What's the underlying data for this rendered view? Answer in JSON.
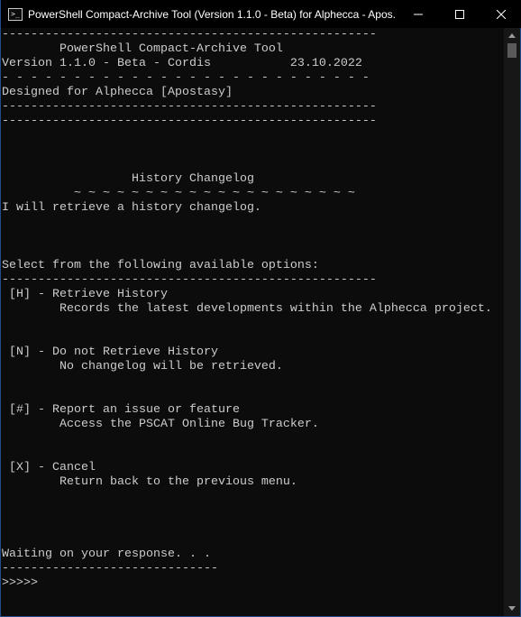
{
  "window": {
    "title": "PowerShell Compact-Archive Tool (Version 1.1.0 - Beta) for Alphecca - Apos...",
    "icon_glyph": ">_"
  },
  "console": {
    "lines": [
      "----------------------------------------------------",
      "        PowerShell Compact-Archive Tool",
      "Version 1.1.0 - Beta - Cordis           23.10.2022",
      "- - - - - - - - - - - - - - - - - - - - - - - - - -",
      "Designed for Alphecca [Apostasy]",
      "----------------------------------------------------",
      "----------------------------------------------------",
      "",
      "",
      "",
      "                  History Changelog",
      "          ~ ~ ~ ~ ~ ~ ~ ~ ~ ~ ~ ~ ~ ~ ~ ~ ~ ~ ~ ~",
      "I will retrieve a history changelog.",
      "",
      "",
      "",
      "Select from the following available options:",
      "----------------------------------------------------",
      " [H] - Retrieve History",
      "        Records the latest developments within the Alphecca project.",
      "",
      "",
      " [N] - Do not Retrieve History",
      "        No changelog will be retrieved.",
      "",
      "",
      " [#] - Report an issue or feature",
      "        Access the PSCAT Online Bug Tracker.",
      "",
      "",
      " [X] - Cancel",
      "        Return back to the previous menu.",
      "",
      "",
      "",
      "",
      "Waiting on your response. . .",
      "------------------------------",
      ">>>>>"
    ]
  },
  "icons": {
    "minimize": "minimize-icon",
    "maximize": "maximize-icon",
    "close": "close-icon"
  },
  "colors": {
    "background": "#0c0c0c",
    "text": "#cccccc",
    "titlebar": "#000000",
    "title_text": "#ffffff"
  }
}
